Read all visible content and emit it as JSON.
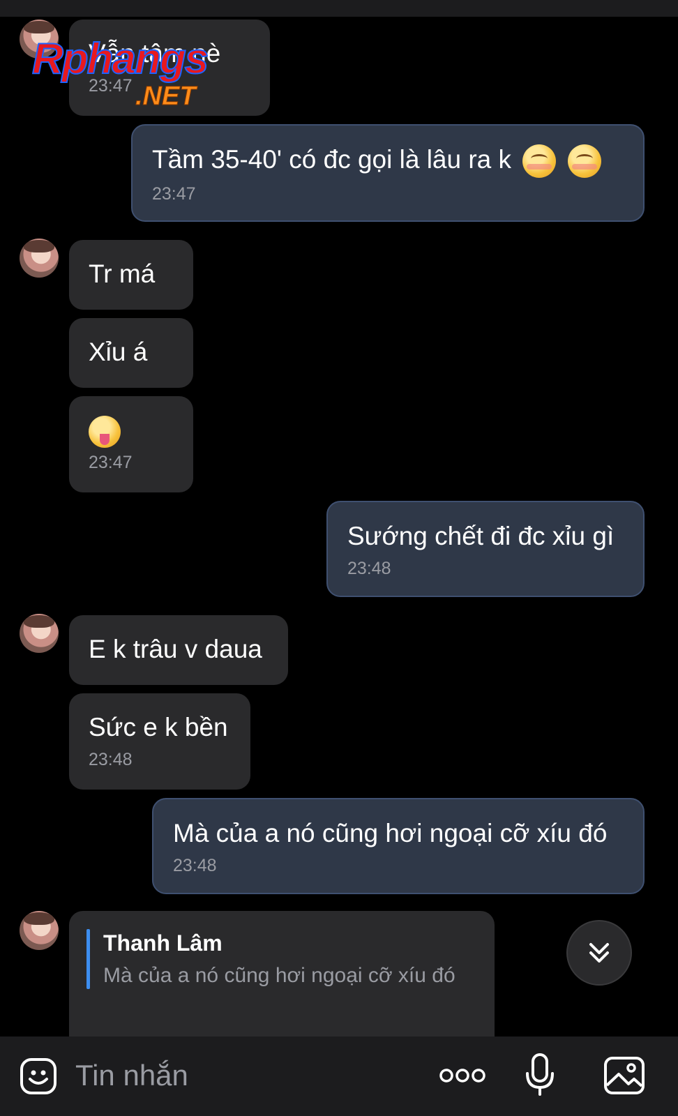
{
  "messages": [
    {
      "text": "Vẫn tâm nè",
      "time": "23:47"
    },
    {
      "text": "Tầm 35-40' có đc gọi là lâu ra k",
      "time": "23:47"
    },
    {
      "text": "Tr má"
    },
    {
      "text": "Xỉu á"
    },
    {
      "time": "23:47"
    },
    {
      "text": "Sướng chết đi đc xỉu gì",
      "time": "23:48"
    },
    {
      "text": "E k trâu v daua"
    },
    {
      "text": "Sức e k bền",
      "time": "23:48"
    },
    {
      "text": "Mà của a nó cũng hơi ngoại cỡ xíu đó",
      "time": "23:48"
    }
  ],
  "reply": {
    "name": "Thanh Lâm",
    "quoted": "Mà của a nó cũng hơi ngoại cỡ xíu đó"
  },
  "composer": {
    "placeholder": "Tin nhắn"
  },
  "watermark": {
    "brand": "Rphangs",
    "suffix": ".NET"
  },
  "icons": {
    "emoji": "smiley-icon",
    "more": "more-dots-icon",
    "mic": "microphone-icon",
    "image": "image-icon",
    "scroll": "double-chevron-down-icon"
  },
  "colors": {
    "background": "#000000",
    "incoming_bubble": "#2a2a2c",
    "outgoing_bubble": "#2f3848",
    "outgoing_border": "#3f5070",
    "reply_accent": "#3d8ef0",
    "timestamp": "#9a9ca3"
  }
}
